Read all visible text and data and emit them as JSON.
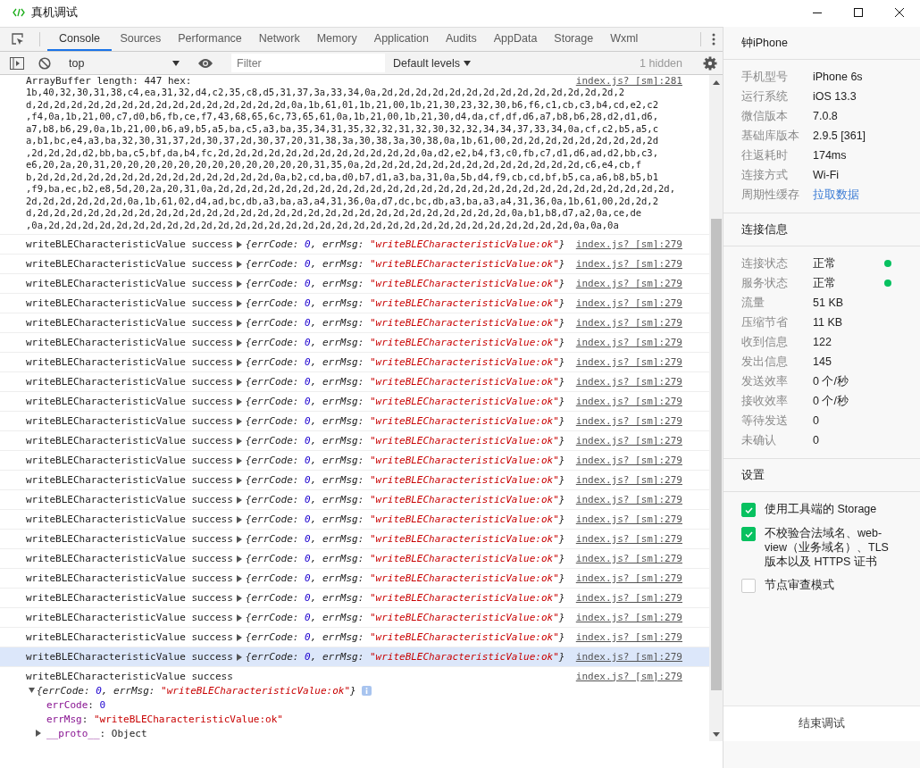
{
  "window": {
    "title": "真机调试"
  },
  "devtools": {
    "tabs": [
      {
        "label": "Console",
        "selected": true
      },
      {
        "label": "Sources",
        "selected": false
      },
      {
        "label": "Performance",
        "selected": false
      },
      {
        "label": "Network",
        "selected": false
      },
      {
        "label": "Memory",
        "selected": false
      },
      {
        "label": "Application",
        "selected": false
      },
      {
        "label": "Audits",
        "selected": false
      },
      {
        "label": "AppData",
        "selected": false
      },
      {
        "label": "Storage",
        "selected": false
      },
      {
        "label": "Wxml",
        "selected": false
      }
    ],
    "toolbar": {
      "context": "top",
      "filter_placeholder": "Filter",
      "levels": "Default levels",
      "hidden_count": "1 hidden"
    },
    "console": {
      "buffer_message": {
        "text": "ArrayBuffer length: 447  hex:",
        "source": "index.js? [sm]:281",
        "hex_lines": [
          "1b,40,32,30,31,38,c4,ea,31,32,d4,c2,35,c8,d5,31,37,3a,33,34,0a,2d,2d,2d,2d,2d,2d,2d,2d,2d,2d,2d,2d,2d,2d,2",
          "d,2d,2d,2d,2d,2d,2d,2d,2d,2d,2d,2d,2d,2d,2d,2d,0a,1b,61,01,1b,21,00,1b,21,30,23,32,30,b6,f6,c1,cb,c3,b4,cd,e2,c2",
          ",f4,0a,1b,21,00,c7,d0,b6,fb,ce,f7,43,68,65,6c,73,65,61,0a,1b,21,00,1b,21,30,d4,da,cf,df,d6,a7,b8,b6,28,d2,d1,d6,",
          "a7,b8,b6,29,0a,1b,21,00,b6,a9,b5,a5,ba,c5,a3,ba,35,34,31,35,32,32,31,32,30,32,32,34,34,37,33,34,0a,cf,c2,b5,a5,c",
          "a,b1,bc,e4,a3,ba,32,30,31,37,2d,30,37,2d,30,37,20,31,38,3a,30,38,3a,30,38,0a,1b,61,00,2d,2d,2d,2d,2d,2d,2d,2d,2d",
          ",2d,2d,2d,d2,bb,ba,c5,bf,da,b4,fc,2d,2d,2d,2d,2d,2d,2d,2d,2d,2d,2d,2d,0a,d2,e2,b4,f3,c0,fb,c7,d1,d6,ad,d2,bb,c3,",
          "e6,20,2a,20,31,20,20,20,20,20,20,20,20,20,20,20,20,31,35,0a,2d,2d,2d,2d,2d,2d,2d,2d,2d,2d,2d,2d,2d,c6,e4,cb,f",
          "b,2d,2d,2d,2d,2d,2d,2d,2d,2d,2d,2d,2d,2d,2d,0a,b2,cd,ba,d0,b7,d1,a3,ba,31,0a,5b,d4,f9,cb,cd,bf,b5,ca,a6,b8,b5,b1",
          ",f9,ba,ec,b2,e8,5d,20,2a,20,31,0a,2d,2d,2d,2d,2d,2d,2d,2d,2d,2d,2d,2d,2d,2d,2d,2d,2d,2d,2d,2d,2d,2d,2d,2d,2d,2d,2d,",
          "2d,2d,2d,2d,2d,2d,0a,1b,61,02,d4,ad,bc,db,a3,ba,a3,a4,31,36,0a,d7,dc,bc,db,a3,ba,a3,a4,31,36,0a,1b,61,00,2d,2d,2",
          "d,2d,2d,2d,2d,2d,2d,2d,2d,2d,2d,2d,2d,2d,2d,2d,2d,2d,2d,2d,2d,2d,2d,2d,2d,2d,2d,2d,2d,0a,b1,b8,d7,a2,0a,ce,de",
          ",0a,2d,2d,2d,2d,2d,2d,2d,2d,2d,2d,2d,2d,2d,2d,2d,2d,2d,2d,2d,2d,2d,2d,2d,2d,2d,2d,2d,2d,2d,2d,2d,0a,0a,0a"
        ]
      },
      "messages": [
        {
          "text": "writeBLECharacteristicValue success",
          "expanded": false,
          "selected": false,
          "source": "index.js? [sm]:279",
          "preview": [
            {
              "text": "{errCode: ",
              "kind": "plain"
            },
            {
              "text": "0",
              "kind": "number"
            },
            {
              "text": ", errMsg: ",
              "kind": "plain"
            },
            {
              "text": "\"writeBLECharacteristicValue:ok\"",
              "kind": "string"
            },
            {
              "text": "}",
              "kind": "plain"
            }
          ]
        },
        {
          "text": "writeBLECharacteristicValue success",
          "expanded": false,
          "selected": false,
          "source": "index.js? [sm]:279",
          "preview": [
            {
              "text": "{errCode: ",
              "kind": "plain"
            },
            {
              "text": "0",
              "kind": "number"
            },
            {
              "text": ", errMsg: ",
              "kind": "plain"
            },
            {
              "text": "\"writeBLECharacteristicValue:ok\"",
              "kind": "string"
            },
            {
              "text": "}",
              "kind": "plain"
            }
          ]
        },
        {
          "text": "writeBLECharacteristicValue success",
          "expanded": false,
          "selected": false,
          "source": "index.js? [sm]:279",
          "preview": [
            {
              "text": "{errCode: ",
              "kind": "plain"
            },
            {
              "text": "0",
              "kind": "number"
            },
            {
              "text": ", errMsg: ",
              "kind": "plain"
            },
            {
              "text": "\"writeBLECharacteristicValue:ok\"",
              "kind": "string"
            },
            {
              "text": "}",
              "kind": "plain"
            }
          ]
        },
        {
          "text": "writeBLECharacteristicValue success",
          "expanded": false,
          "selected": false,
          "source": "index.js? [sm]:279",
          "preview": [
            {
              "text": "{errCode: ",
              "kind": "plain"
            },
            {
              "text": "0",
              "kind": "number"
            },
            {
              "text": ", errMsg: ",
              "kind": "plain"
            },
            {
              "text": "\"writeBLECharacteristicValue:ok\"",
              "kind": "string"
            },
            {
              "text": "}",
              "kind": "plain"
            }
          ]
        },
        {
          "text": "writeBLECharacteristicValue success",
          "expanded": false,
          "selected": false,
          "source": "index.js? [sm]:279",
          "preview": [
            {
              "text": "{errCode: ",
              "kind": "plain"
            },
            {
              "text": "0",
              "kind": "number"
            },
            {
              "text": ", errMsg: ",
              "kind": "plain"
            },
            {
              "text": "\"writeBLECharacteristicValue:ok\"",
              "kind": "string"
            },
            {
              "text": "}",
              "kind": "plain"
            }
          ]
        },
        {
          "text": "writeBLECharacteristicValue success",
          "expanded": false,
          "selected": false,
          "source": "index.js? [sm]:279",
          "preview": [
            {
              "text": "{errCode: ",
              "kind": "plain"
            },
            {
              "text": "0",
              "kind": "number"
            },
            {
              "text": ", errMsg: ",
              "kind": "plain"
            },
            {
              "text": "\"writeBLECharacteristicValue:ok\"",
              "kind": "string"
            },
            {
              "text": "}",
              "kind": "plain"
            }
          ]
        },
        {
          "text": "writeBLECharacteristicValue success",
          "expanded": false,
          "selected": false,
          "source": "index.js? [sm]:279",
          "preview": [
            {
              "text": "{errCode: ",
              "kind": "plain"
            },
            {
              "text": "0",
              "kind": "number"
            },
            {
              "text": ", errMsg: ",
              "kind": "plain"
            },
            {
              "text": "\"writeBLECharacteristicValue:ok\"",
              "kind": "string"
            },
            {
              "text": "}",
              "kind": "plain"
            }
          ]
        },
        {
          "text": "writeBLECharacteristicValue success",
          "expanded": false,
          "selected": false,
          "source": "index.js? [sm]:279",
          "preview": [
            {
              "text": "{errCode: ",
              "kind": "plain"
            },
            {
              "text": "0",
              "kind": "number"
            },
            {
              "text": ", errMsg: ",
              "kind": "plain"
            },
            {
              "text": "\"writeBLECharacteristicValue:ok\"",
              "kind": "string"
            },
            {
              "text": "}",
              "kind": "plain"
            }
          ]
        },
        {
          "text": "writeBLECharacteristicValue success",
          "expanded": false,
          "selected": false,
          "source": "index.js? [sm]:279",
          "preview": [
            {
              "text": "{errCode: ",
              "kind": "plain"
            },
            {
              "text": "0",
              "kind": "number"
            },
            {
              "text": ", errMsg: ",
              "kind": "plain"
            },
            {
              "text": "\"writeBLECharacteristicValue:ok\"",
              "kind": "string"
            },
            {
              "text": "}",
              "kind": "plain"
            }
          ]
        },
        {
          "text": "writeBLECharacteristicValue success",
          "expanded": false,
          "selected": false,
          "source": "index.js? [sm]:279",
          "preview": [
            {
              "text": "{errCode: ",
              "kind": "plain"
            },
            {
              "text": "0",
              "kind": "number"
            },
            {
              "text": ", errMsg: ",
              "kind": "plain"
            },
            {
              "text": "\"writeBLECharacteristicValue:ok\"",
              "kind": "string"
            },
            {
              "text": "}",
              "kind": "plain"
            }
          ]
        },
        {
          "text": "writeBLECharacteristicValue success",
          "expanded": false,
          "selected": false,
          "source": "index.js? [sm]:279",
          "preview": [
            {
              "text": "{errCode: ",
              "kind": "plain"
            },
            {
              "text": "0",
              "kind": "number"
            },
            {
              "text": ", errMsg: ",
              "kind": "plain"
            },
            {
              "text": "\"writeBLECharacteristicValue:ok\"",
              "kind": "string"
            },
            {
              "text": "}",
              "kind": "plain"
            }
          ]
        },
        {
          "text": "writeBLECharacteristicValue success",
          "expanded": false,
          "selected": false,
          "source": "index.js? [sm]:279",
          "preview": [
            {
              "text": "{errCode: ",
              "kind": "plain"
            },
            {
              "text": "0",
              "kind": "number"
            },
            {
              "text": ", errMsg: ",
              "kind": "plain"
            },
            {
              "text": "\"writeBLECharacteristicValue:ok\"",
              "kind": "string"
            },
            {
              "text": "}",
              "kind": "plain"
            }
          ]
        },
        {
          "text": "writeBLECharacteristicValue success",
          "expanded": false,
          "selected": false,
          "source": "index.js? [sm]:279",
          "preview": [
            {
              "text": "{errCode: ",
              "kind": "plain"
            },
            {
              "text": "0",
              "kind": "number"
            },
            {
              "text": ", errMsg: ",
              "kind": "plain"
            },
            {
              "text": "\"writeBLECharacteristicValue:ok\"",
              "kind": "string"
            },
            {
              "text": "}",
              "kind": "plain"
            }
          ]
        },
        {
          "text": "writeBLECharacteristicValue success",
          "expanded": false,
          "selected": false,
          "source": "index.js? [sm]:279",
          "preview": [
            {
              "text": "{errCode: ",
              "kind": "plain"
            },
            {
              "text": "0",
              "kind": "number"
            },
            {
              "text": ", errMsg: ",
              "kind": "plain"
            },
            {
              "text": "\"writeBLECharacteristicValue:ok\"",
              "kind": "string"
            },
            {
              "text": "}",
              "kind": "plain"
            }
          ]
        },
        {
          "text": "writeBLECharacteristicValue success",
          "expanded": false,
          "selected": false,
          "source": "index.js? [sm]:279",
          "preview": [
            {
              "text": "{errCode: ",
              "kind": "plain"
            },
            {
              "text": "0",
              "kind": "number"
            },
            {
              "text": ", errMsg: ",
              "kind": "plain"
            },
            {
              "text": "\"writeBLECharacteristicValue:ok\"",
              "kind": "string"
            },
            {
              "text": "}",
              "kind": "plain"
            }
          ]
        },
        {
          "text": "writeBLECharacteristicValue success",
          "expanded": false,
          "selected": false,
          "source": "index.js? [sm]:279",
          "preview": [
            {
              "text": "{errCode: ",
              "kind": "plain"
            },
            {
              "text": "0",
              "kind": "number"
            },
            {
              "text": ", errMsg: ",
              "kind": "plain"
            },
            {
              "text": "\"writeBLECharacteristicValue:ok\"",
              "kind": "string"
            },
            {
              "text": "}",
              "kind": "plain"
            }
          ]
        },
        {
          "text": "writeBLECharacteristicValue success",
          "expanded": false,
          "selected": false,
          "source": "index.js? [sm]:279",
          "preview": [
            {
              "text": "{errCode: ",
              "kind": "plain"
            },
            {
              "text": "0",
              "kind": "number"
            },
            {
              "text": ", errMsg: ",
              "kind": "plain"
            },
            {
              "text": "\"writeBLECharacteristicValue:ok\"",
              "kind": "string"
            },
            {
              "text": "}",
              "kind": "plain"
            }
          ]
        },
        {
          "text": "writeBLECharacteristicValue success",
          "expanded": false,
          "selected": false,
          "source": "index.js? [sm]:279",
          "preview": [
            {
              "text": "{errCode: ",
              "kind": "plain"
            },
            {
              "text": "0",
              "kind": "number"
            },
            {
              "text": ", errMsg: ",
              "kind": "plain"
            },
            {
              "text": "\"writeBLECharacteristicValue:ok\"",
              "kind": "string"
            },
            {
              "text": "}",
              "kind": "plain"
            }
          ]
        },
        {
          "text": "writeBLECharacteristicValue success",
          "expanded": false,
          "selected": false,
          "source": "index.js? [sm]:279",
          "preview": [
            {
              "text": "{errCode: ",
              "kind": "plain"
            },
            {
              "text": "0",
              "kind": "number"
            },
            {
              "text": ", errMsg: ",
              "kind": "plain"
            },
            {
              "text": "\"writeBLECharacteristicValue:ok\"",
              "kind": "string"
            },
            {
              "text": "}",
              "kind": "plain"
            }
          ]
        },
        {
          "text": "writeBLECharacteristicValue success",
          "expanded": false,
          "selected": false,
          "source": "index.js? [sm]:279",
          "preview": [
            {
              "text": "{errCode: ",
              "kind": "plain"
            },
            {
              "text": "0",
              "kind": "number"
            },
            {
              "text": ", errMsg: ",
              "kind": "plain"
            },
            {
              "text": "\"writeBLECharacteristicValue:ok\"",
              "kind": "string"
            },
            {
              "text": "}",
              "kind": "plain"
            }
          ]
        },
        {
          "text": "writeBLECharacteristicValue success",
          "expanded": false,
          "selected": false,
          "source": "index.js? [sm]:279",
          "preview": [
            {
              "text": "{errCode: ",
              "kind": "plain"
            },
            {
              "text": "0",
              "kind": "number"
            },
            {
              "text": ", errMsg: ",
              "kind": "plain"
            },
            {
              "text": "\"writeBLECharacteristicValue:ok\"",
              "kind": "string"
            },
            {
              "text": "}",
              "kind": "plain"
            }
          ]
        },
        {
          "text": "writeBLECharacteristicValue success",
          "expanded": false,
          "selected": true,
          "source": "index.js? [sm]:279",
          "preview": [
            {
              "text": "{errCode: ",
              "kind": "plain"
            },
            {
              "text": "0",
              "kind": "number"
            },
            {
              "text": ", errMsg: ",
              "kind": "plain"
            },
            {
              "text": "\"writeBLECharacteristicValue:ok\"",
              "kind": "string"
            },
            {
              "text": "}",
              "kind": "plain"
            }
          ]
        },
        {
          "text": "writeBLECharacteristicValue success",
          "expanded": true,
          "selected": false,
          "source": "index.js? [sm]:279",
          "preview": [
            {
              "text": "{errCode: ",
              "kind": "plain"
            },
            {
              "text": "0",
              "kind": "number"
            },
            {
              "text": ", errMsg: ",
              "kind": "plain"
            },
            {
              "text": "\"writeBLECharacteristicValue:ok\"",
              "kind": "string"
            },
            {
              "text": "}",
              "kind": "plain"
            }
          ],
          "properties": [
            {
              "kind": "field",
              "pieces": [
                {
                  "text": "errCode",
                  "kind": "prop"
                },
                {
                  "text": ": ",
                  "kind": "plain"
                },
                {
                  "text": "0",
                  "kind": "number"
                }
              ]
            },
            {
              "kind": "field",
              "pieces": [
                {
                  "text": "errMsg",
                  "kind": "prop"
                },
                {
                  "text": ": ",
                  "kind": "plain"
                },
                {
                  "text": "\"writeBLECharacteristicValue:ok\"",
                  "kind": "string"
                }
              ]
            },
            {
              "kind": "object",
              "pieces": [
                {
                  "text": "__proto__",
                  "kind": "proto"
                },
                {
                  "text": ": Object",
                  "kind": "plain"
                }
              ]
            }
          ]
        }
      ]
    }
  },
  "device_panel": {
    "title": "钟iPhone",
    "device_info": [
      {
        "label": "手机型号",
        "value": "iPhone 6s",
        "kind": "text"
      },
      {
        "label": "运行系统",
        "value": "iOS 13.3",
        "kind": "text"
      },
      {
        "label": "微信版本",
        "value": "7.0.8",
        "kind": "text"
      },
      {
        "label": "基础库版本",
        "value": "2.9.5 [361]",
        "kind": "text"
      },
      {
        "label": "往返耗时",
        "value": "174ms",
        "kind": "text"
      },
      {
        "label": "连接方式",
        "value": "Wi-Fi",
        "kind": "text"
      },
      {
        "label": "周期性缓存",
        "value": "拉取数据",
        "kind": "link"
      }
    ],
    "connection": {
      "title": "连接信息",
      "rows": [
        {
          "label": "连接状态",
          "value": "正常",
          "kind": "status",
          "color": "#07c160"
        },
        {
          "label": "服务状态",
          "value": "正常",
          "kind": "status",
          "color": "#07c160"
        },
        {
          "label": "流量",
          "value": "51 KB",
          "kind": "plain"
        },
        {
          "label": "压缩节省",
          "value": "11 KB",
          "kind": "plain"
        },
        {
          "label": "收到信息",
          "value": "122",
          "kind": "plain"
        },
        {
          "label": "发出信息",
          "value": "145",
          "kind": "plain"
        },
        {
          "label": "发送效率",
          "value": "0 个/秒",
          "kind": "plain"
        },
        {
          "label": "接收效率",
          "value": "0 个/秒",
          "kind": "plain"
        },
        {
          "label": "等待发送",
          "value": "0",
          "kind": "plain"
        },
        {
          "label": "未确认",
          "value": "0",
          "kind": "plain"
        }
      ]
    },
    "settings": {
      "title": "设置",
      "options": [
        {
          "label": "使用工具端的 Storage",
          "checked": true
        },
        {
          "label": "不校验合法域名、web-view（业务域名）、TLS 版本以及 HTTPS 证书",
          "checked": true
        },
        {
          "label": "节点审查模式",
          "checked": false
        }
      ]
    },
    "end_button": "结束调试"
  }
}
